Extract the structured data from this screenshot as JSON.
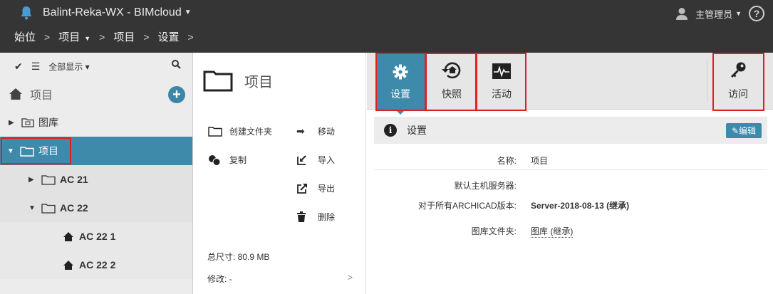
{
  "topbar": {
    "title": "Balint-Reka-WX - BIMcloud",
    "breadcrumbs": [
      "始位",
      "项目",
      "项目",
      "设置"
    ],
    "user": "主管理员",
    "help": "?"
  },
  "sidebar": {
    "show_all": "全部显示",
    "root": "项目",
    "items": [
      {
        "label": "图库"
      },
      {
        "label": "项目"
      },
      {
        "label": "AC 21"
      },
      {
        "label": "AC 22"
      },
      {
        "label": "AC 22 1"
      },
      {
        "label": "AC 22 2"
      }
    ]
  },
  "middle": {
    "title": "项目",
    "actions": {
      "new_folder": "创建文件夹",
      "move": "移动",
      "copy": "复制",
      "import": "导入",
      "export": "导出",
      "delete": "删除"
    },
    "total_size": "总尺寸: 80.9 MB",
    "modified": "修改: -"
  },
  "tabs": {
    "settings": "设置",
    "snapshot": "快照",
    "activity": "活动",
    "access": "访问"
  },
  "settings": {
    "section_title": "设置",
    "edit": "编辑",
    "props": [
      {
        "key": "名称:",
        "value": "项目"
      },
      {
        "key": "默认主机服务器:",
        "value": ""
      },
      {
        "key": "对于所有ARCHICAD版本:",
        "value": "Server-2018-08-13 (继承)"
      },
      {
        "key": "图库文件夹:",
        "value": "图库 (继承)"
      }
    ]
  },
  "colors": {
    "topbar": "#353535",
    "accent": "#3e8aab",
    "highlight_box": "#e02020"
  }
}
